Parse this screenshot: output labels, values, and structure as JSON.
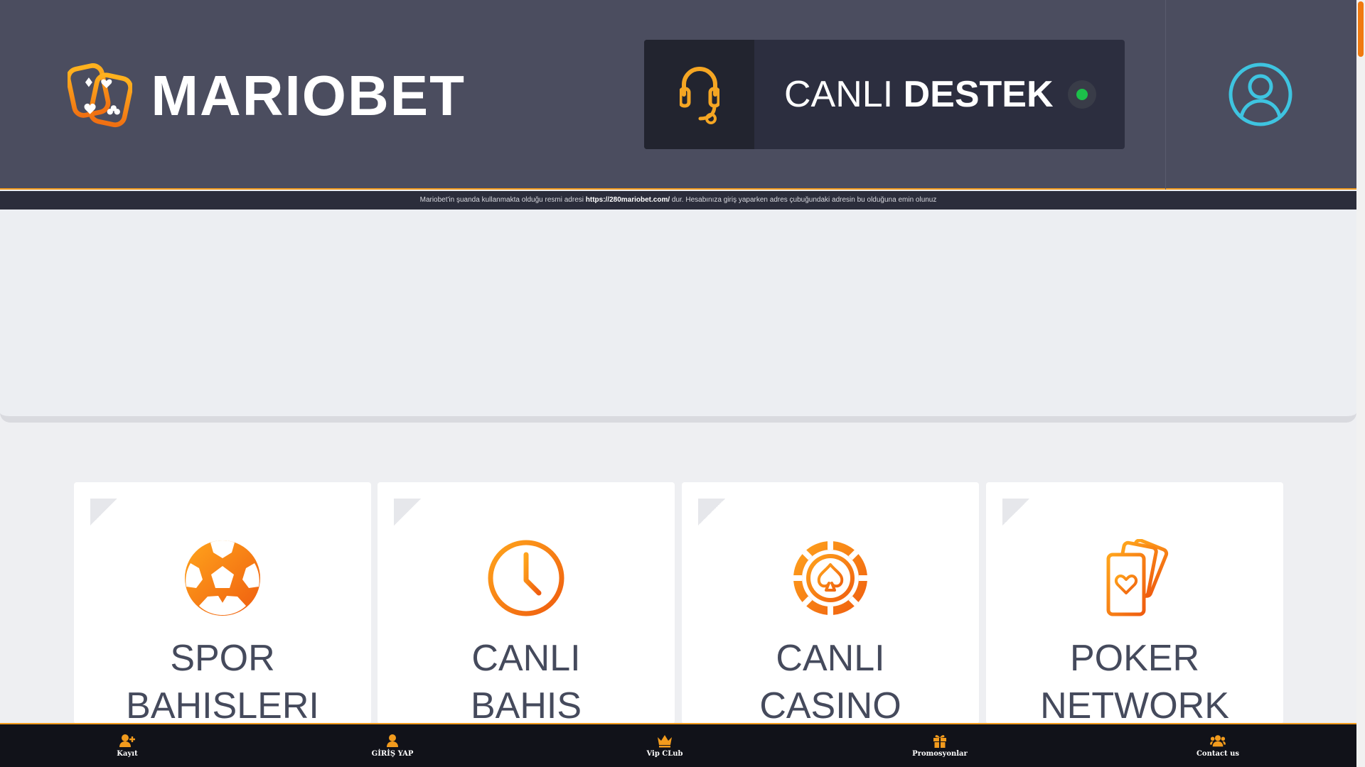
{
  "header": {
    "logo_text": "MARIOBET",
    "support": {
      "prefix": "CANLI",
      "bold": "DESTEK"
    }
  },
  "infobar": {
    "before": "Mariobet'in şuanda kullanmakta olduğu resmi adresi",
    "url": "https://280mariobet.com/",
    "after": "dur. Hesabınıza giriş yaparken adres çubuğundaki adresin bu olduğuna emin olunuz"
  },
  "cards": [
    {
      "line1": "SPOR",
      "line2": "BAHISLERI",
      "icon": "soccer-ball-icon"
    },
    {
      "line1": "CANLI",
      "line2": "BAHIS",
      "icon": "clock-icon"
    },
    {
      "line1": "CANLI",
      "line2": "CASINO",
      "icon": "casino-chip-icon"
    },
    {
      "line1": "POKER",
      "line2": "NETWORK",
      "icon": "playing-cards-icon"
    }
  ],
  "bottomnav": [
    {
      "label": "Kayıt",
      "icon": "user-plus-icon"
    },
    {
      "label": "GİRİŞ YAP",
      "icon": "user-icon"
    },
    {
      "label": "Vip CLub",
      "icon": "crown-icon"
    },
    {
      "label": "Promosyonlar",
      "icon": "gift-icon"
    },
    {
      "label": "Contact us",
      "icon": "users-icon"
    }
  ],
  "colors": {
    "accent": "#f29b1d",
    "header_bg": "#4b4d5f",
    "support_bg": "#2c2e3f",
    "online": "#1cc04a",
    "user_icon": "#3ec4e0",
    "nav_bg": "#111219"
  }
}
